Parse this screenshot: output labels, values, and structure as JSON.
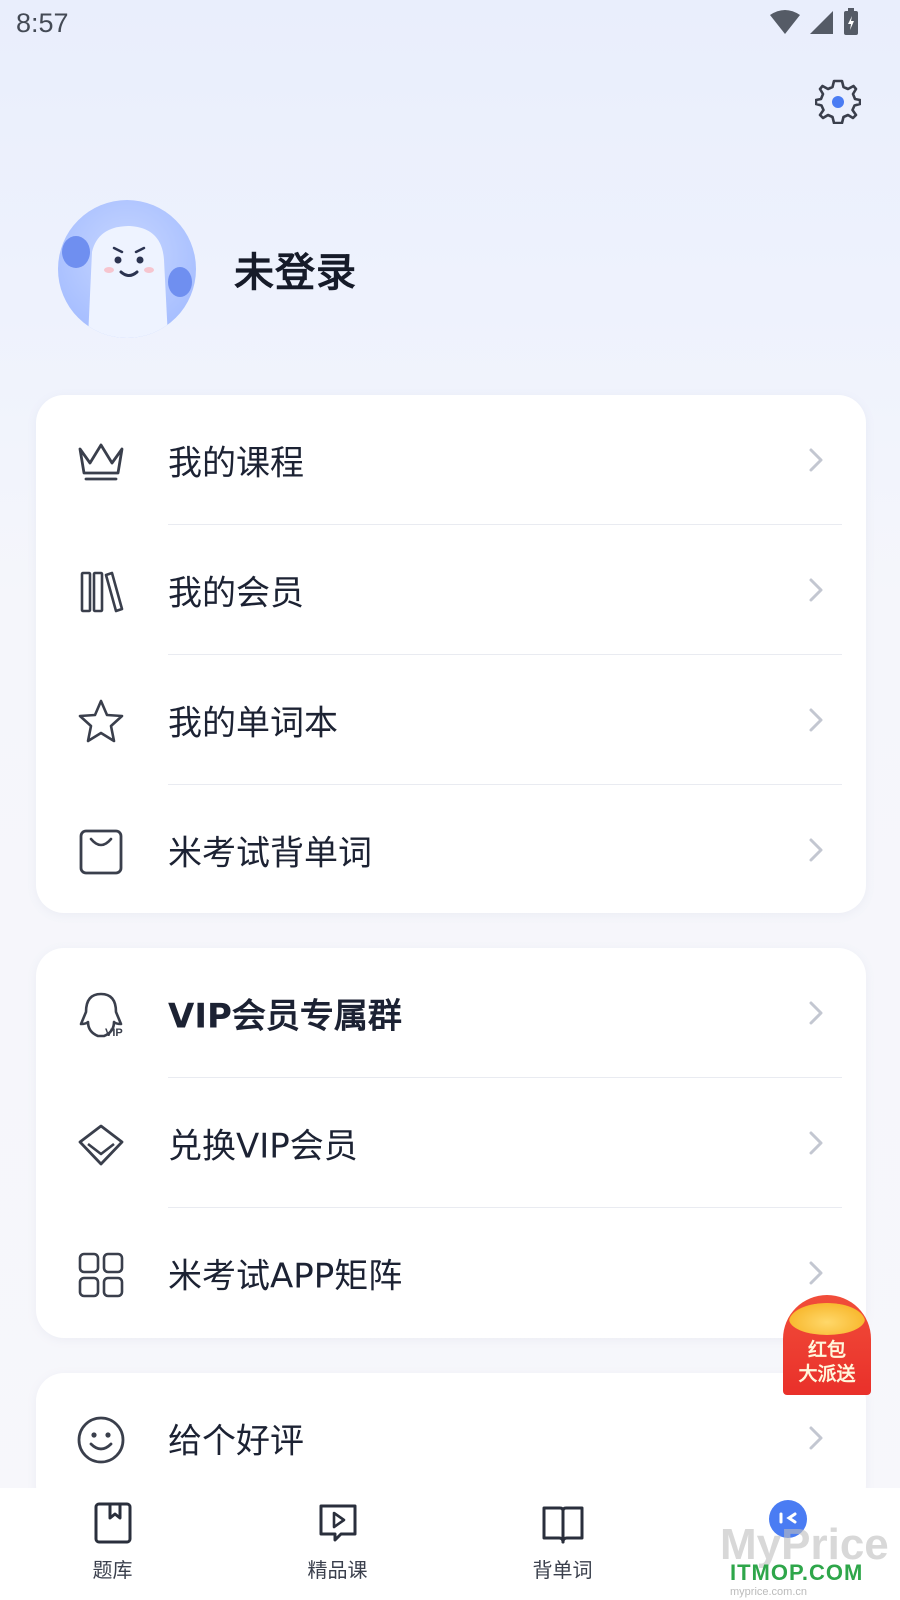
{
  "status_bar": {
    "time": "8:57"
  },
  "profile": {
    "username": "未登录"
  },
  "card1": {
    "items": [
      {
        "label": "我的课程",
        "icon": "crown-icon"
      },
      {
        "label": "我的会员",
        "icon": "books-icon"
      },
      {
        "label": "我的单词本",
        "icon": "star-icon"
      },
      {
        "label": "米考试背单词",
        "icon": "bag-icon"
      }
    ]
  },
  "card2": {
    "items": [
      {
        "label": "VIP会员专属群",
        "icon": "qq-vip-icon"
      },
      {
        "label": "兑换VIP会员",
        "icon": "diamond-icon"
      },
      {
        "label": "米考试APP矩阵",
        "icon": "grid-apps-icon"
      }
    ]
  },
  "card3": {
    "items": [
      {
        "label": "给个好评",
        "icon": "smile-icon"
      }
    ]
  },
  "red_packet": {
    "line1": "红包",
    "line2": "大派送"
  },
  "tabbar": {
    "tabs": [
      {
        "label": "题库",
        "icon": "bookmark-book-icon"
      },
      {
        "label": "精品课",
        "icon": "play-icon"
      },
      {
        "label": "背单词",
        "icon": "open-book-icon"
      },
      {
        "label": "",
        "icon": "profile-active-icon"
      }
    ]
  },
  "watermark": {
    "big": "MyPrice",
    "small": "ITMOP.COM",
    "tiny": "myprice.com.cn"
  },
  "colors": {
    "accent": "#4a7cf3",
    "text": "#1c2233",
    "chevron": "#c3c7d1",
    "red_packet": "#e9302a"
  }
}
